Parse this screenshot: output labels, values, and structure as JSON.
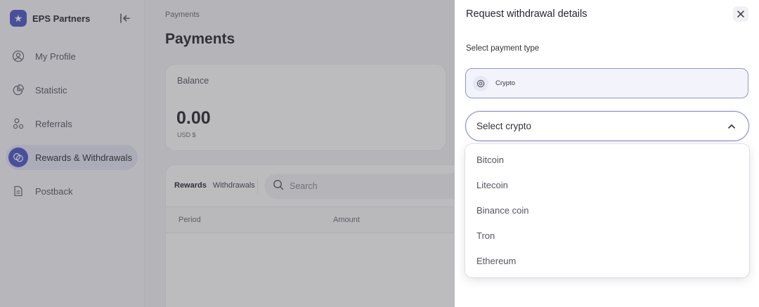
{
  "brand": {
    "name": "EPS Partners",
    "logo_icon": "star-icon"
  },
  "sidebar": {
    "items": [
      {
        "label": "My Profile",
        "icon": "user-circle-icon",
        "active": false
      },
      {
        "label": "Statistic",
        "icon": "pie-chart-icon",
        "active": false
      },
      {
        "label": "Referrals",
        "icon": "users-icon",
        "active": false
      },
      {
        "label": "Rewards & Withdrawals",
        "icon": "coins-icon",
        "active": true
      },
      {
        "label": "Postback",
        "icon": "document-icon",
        "active": false
      }
    ]
  },
  "main": {
    "breadcrumb": "Payments",
    "title": "Payments",
    "balance": {
      "label": "Balance",
      "value": "0.00",
      "currency": "USD $"
    },
    "tabs": [
      {
        "label": "Rewards",
        "active": true
      },
      {
        "label": "Withdrawals",
        "active": false
      }
    ],
    "search": {
      "placeholder": "Search"
    },
    "table": {
      "columns": [
        "Period",
        "Amount"
      ]
    }
  },
  "drawer": {
    "title": "Request withdrawal details",
    "section_label": "Select payment type",
    "payment_type": {
      "label": "Crypto",
      "icon": "crypto-coin-icon"
    },
    "select": {
      "placeholder": "Select crypto",
      "expanded": true
    },
    "options": [
      "Bitcoin",
      "Litecoin",
      "Binance coin",
      "Tron",
      "Ethereum"
    ]
  },
  "colors": {
    "accent": "#4a55c9",
    "select_border": "#7f8ad6",
    "overlay": "rgba(70,70,78,0.36)"
  }
}
